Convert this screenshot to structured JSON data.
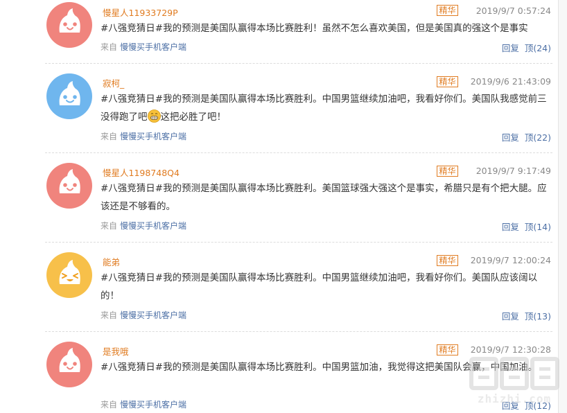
{
  "colors": {
    "username": "#e07b20",
    "badge": "#e07b20",
    "link": "#4c6fa5",
    "avatar_pink": "#f0847d",
    "avatar_blue": "#6fb6ee",
    "avatar_yellow": "#f7c04a"
  },
  "labels": {
    "badge": "精华",
    "source_prefix": "来自",
    "source_link": "慢慢买手机客户端",
    "reply": "回复",
    "upvote_prefix": "顶"
  },
  "comments": [
    {
      "avatar_icon": "pink-face-icon",
      "username": "慢星人11933729P",
      "time": "2019/9/7 0:57:24",
      "text": "#八强竞猜日#我的预测是美国队赢得本场比赛胜利！虽然不怎么喜欢美国，但是美国真的强这个是事实",
      "upvotes": "顶(24)"
    },
    {
      "avatar_icon": "blue-face-icon",
      "username": "寂柯_",
      "time": "2019/9/6 21:43:09",
      "text": "#八强竞猜日#我的预测是美国队赢得本场比赛胜利。中国男篮继续加油吧，我看好你们。美国队我感觉前三没得跑了吧",
      "text_after_emoji": "这把必胜了吧！",
      "upvotes": "顶(22)"
    },
    {
      "avatar_icon": "pink-face-icon",
      "username": "慢星人1198748Q4",
      "time": "2019/9/7 9:17:49",
      "text": "#八强竞猜日#我的预测是美国队赢得本场比赛胜利。美国篮球强大强这个是事实，希腊只是有个把大腿。应该还是不够看的。",
      "upvotes": "顶(14)"
    },
    {
      "avatar_icon": "yellow-face-icon",
      "username": "能弟",
      "time": "2019/9/7 12:00:24",
      "text": "#八强竞猜日#我的预测是美国队赢得本场比赛胜利。中国男篮继续加油吧，我看好你们。美国队应该阔以的！",
      "upvotes": "顶(13)"
    },
    {
      "avatar_icon": "pink-face-icon",
      "username": "是我哦",
      "time": "2019/9/7 12:30:28",
      "text": "#八强竞猜日#我的预测是美国队赢得本场比赛胜利。中国男篮加油，我觉得这把美国队会赢，中国加油。",
      "upvotes": "顶(12)"
    }
  ],
  "watermark": {
    "logo": "值",
    "site": "zhizhi.com"
  }
}
